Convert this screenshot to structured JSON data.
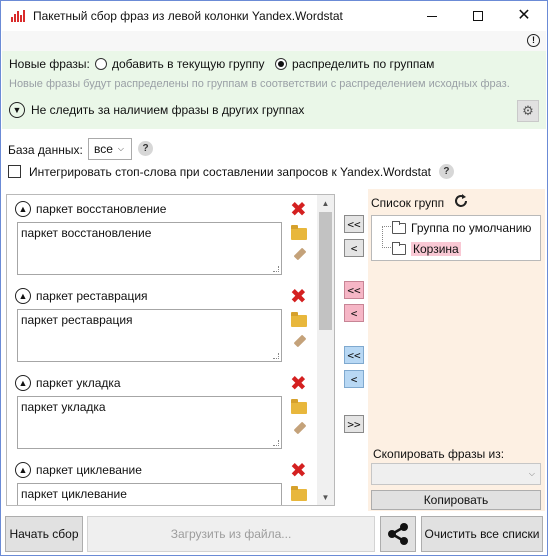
{
  "window": {
    "title": "Пакетный сбор фраз из левой колонки Yandex.Wordstat",
    "minimize_icon": "minimize-icon",
    "maximize_icon": "maximize-icon",
    "close_glyph": "✕"
  },
  "alert": {
    "icon_text": "!"
  },
  "new_phrases": {
    "label": "Новые фразы:",
    "option_add": "добавить в текущую группу",
    "option_distribute": "распределить по группам",
    "selected": "option_distribute",
    "hint": "Новые фразы будут распределены по группам в соответствии с распределением исходных фраз.",
    "follow_label": "Не следить за наличием фразы в других группах"
  },
  "database": {
    "label": "База данных:",
    "value": "все",
    "help": "?"
  },
  "stopwords": {
    "label": "Интегрировать стоп-слова при составлении запросов к Yandex.Wordstat",
    "checked": false,
    "help": "?"
  },
  "groups": [
    {
      "title": "паркет восстановление",
      "phrases": "паркет восстановление"
    },
    {
      "title": "паркет реставрация",
      "phrases": "паркет реставрация"
    },
    {
      "title": "паркет укладка",
      "phrases": "паркет укладка"
    },
    {
      "title": "паркет циклевание",
      "phrases": "паркет циклевание"
    }
  ],
  "transfer_buttons": {
    "grey_all": "<<",
    "grey_one": "<",
    "pink_all": "<<",
    "pink_one": "<",
    "blue_all": "<<",
    "blue_one": "<",
    "forward": ">>"
  },
  "group_list": {
    "title": "Список групп",
    "items": [
      "Группа по умолчанию",
      "Корзина"
    ],
    "selected_item": "Корзина"
  },
  "copy": {
    "label": "Скопировать фразы из:",
    "select_value": "",
    "button": "Копировать"
  },
  "bottom": {
    "start": "Начать сбор",
    "load": "Загрузить из файла...",
    "clear": "Очистить все списки"
  },
  "colors": {
    "green_panel": "#eaf7e8",
    "right_panel": "#fdf0e3",
    "delete_red": "#d42020",
    "pink_button": "#f6b6c6",
    "blue_button": "#b8d8f4"
  }
}
